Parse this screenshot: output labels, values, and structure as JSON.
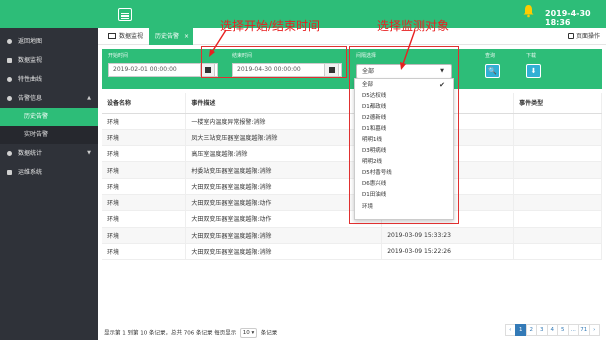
{
  "topbar": {
    "datetime": "2019-4-30 18:36",
    "accent": "#2dbd78"
  },
  "sidebar": {
    "items": [
      {
        "label": "返回地图"
      },
      {
        "label": "数据监视"
      },
      {
        "label": "特性曲线"
      },
      {
        "label": "告警信息"
      },
      {
        "label": "数据统计"
      },
      {
        "label": "运维系统"
      }
    ],
    "alarm_sub": [
      {
        "label": "历史告警"
      },
      {
        "label": "实时告警"
      }
    ]
  },
  "tabs": {
    "tab1": "数据监视",
    "tab2": "历史告警",
    "close": "×",
    "page_op": "页面操作"
  },
  "filters": {
    "start_label": "开始时间",
    "end_label": "结束时间",
    "target_label": "间隔选择",
    "query_label": "查询",
    "download_label": "下载",
    "start_value": "2019-02-01 00:00:00",
    "end_value": "2019-04-30 00:00:00",
    "target_value": "全部",
    "search_glyph": "🔍",
    "download_glyph": "⬇"
  },
  "dropdown": {
    "options": [
      "全部",
      "D5达权线",
      "D1都政线",
      "D2德新线",
      "D1和墓线",
      "明明1线",
      "D3明病线",
      "明明2线",
      "D5村香号线",
      "D6惠兴线",
      "D1田油线",
      "环境"
    ],
    "checkmark": "✔"
  },
  "table": {
    "headers": [
      "设备名称",
      "事件描述",
      "",
      "事件类型"
    ],
    "rows": [
      [
        "环境",
        "一楼室内温度异常报警:消除",
        "",
        ""
      ],
      [
        "环境",
        "凤大三站变压器室温度越限:消除",
        "",
        ""
      ],
      [
        "环境",
        "高压室温度越限:消除",
        "",
        ""
      ],
      [
        "环境",
        "村委站变压器室温度越限:消除",
        "",
        ""
      ],
      [
        "环境",
        "大田双变压器室温度越限:消除",
        "",
        ""
      ],
      [
        "环境",
        "大田双变压器室温度越限:动作",
        "2019-03-09 16:45:23",
        ""
      ],
      [
        "环境",
        "大田双变压器室温度越限:动作",
        "2019-03-09 16:19:24",
        ""
      ],
      [
        "环境",
        "大田双变压器室温度越限:消除",
        "2019-03-09 15:33:23",
        ""
      ],
      [
        "环境",
        "大田双变压器室温度越限:消除",
        "2019-03-09 15:22:26",
        ""
      ]
    ]
  },
  "footer": {
    "info_before": "显示第 1 到第 10 条记录，总共 706 条记录 每页显示",
    "page_len": "10 ▾",
    "info_after": "条记录",
    "pages": [
      "‹",
      "1",
      "2",
      "3",
      "4",
      "5",
      "...",
      "71",
      "›"
    ]
  },
  "annotations": {
    "time_label": "选择开始/结束时间",
    "target_label": "选择监测对象",
    "color": "#e82020"
  }
}
